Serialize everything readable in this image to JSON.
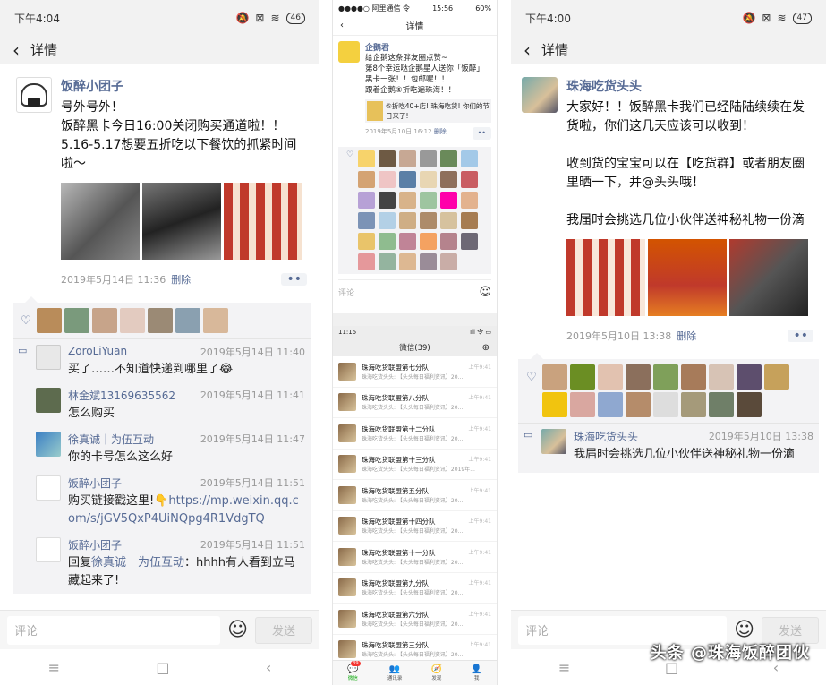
{
  "left": {
    "status": {
      "time": "下午4:04",
      "battery": "46"
    },
    "title": "详情",
    "post": {
      "author": "饭醉小团子",
      "text": "号外号外！\n饭醉黑卡今日16:00关闭购买通道啦！！5.16-5.17想要五折吃以下餐饮的抓紧时间啦～",
      "time": "2019年5月14日 11:36",
      "delete": "删除"
    },
    "comments": [
      {
        "name": "ZoroLiYuan",
        "time": "2019年5月14日 11:40",
        "text": "买了……不知道快递到哪里了😂"
      },
      {
        "name": "林金斌13169635562",
        "time": "2019年5月14日 11:41",
        "text": "怎么购买"
      },
      {
        "name": "徐真诚｜为伍互动",
        "time": "2019年5月14日 11:47",
        "text": "你的卡号怎么这么好"
      },
      {
        "name": "饭醉小团子",
        "time": "2019年5月14日 11:51",
        "text": "购买链接戳这里!👇",
        "link": "https://mp.weixin.qq.com/s/jGV5QxP4UiNQpg4R1VdgTQ"
      },
      {
        "name": "饭醉小团子",
        "time": "2019年5月14日 11:51",
        "reply_prefix": "回复",
        "reply_to": "徐真诚｜为伍互动",
        "text": "：hhhh有人看到立马藏起来了!"
      }
    ],
    "input_placeholder": "评论",
    "send": "发送"
  },
  "middle": {
    "status": {
      "carrier": "●●●●○ 阿里通信 令",
      "time": "15:56",
      "battery": "60%"
    },
    "title": "详情",
    "post": {
      "author": "企鹅君",
      "text": "给企鹅这条胖友圈点赞~\n第8个幸运哒企鹅星人送你「饭醉」黑卡一张！！包邮喔！！\n跟着企鹅⑤折吃遍珠海！！",
      "share": "⑤折吃40+店! 珠海吃货! 你们的节日来了!",
      "time": "2019年5月10日 16:12",
      "delete": "删除"
    },
    "input_placeholder": "评论",
    "chat_status": {
      "time": "11:15",
      "icons": "ıll 令 ▭"
    },
    "chat_title": "微信(39)",
    "chats": [
      {
        "name": "珠海吃货联盟第七分队",
        "msg": "珠海吃货头头: 【头头每日福利资讯】20...",
        "time": "上午9:41"
      },
      {
        "name": "珠海吃货联盟第八分队",
        "msg": "珠海吃货头头: 【头头每日福利资讯】20...",
        "time": "上午9:41"
      },
      {
        "name": "珠海吃货联盟第十二分队",
        "msg": "珠海吃货头头: 【头头每日福利资讯】20...",
        "time": "上午9:41"
      },
      {
        "name": "珠海吃货联盟第十三分队",
        "msg": "珠海吃货头头: 【头头每日福利资讯】2019年...",
        "time": "上午9:41"
      },
      {
        "name": "珠海吃货联盟第五分队",
        "msg": "珠海吃货头头: 【头头每日福利资讯】20...",
        "time": "上午9:41"
      },
      {
        "name": "珠海吃货联盟第十四分队",
        "msg": "珠海吃货头头: 【头头每日福利资讯】20...",
        "time": "上午9:41"
      },
      {
        "name": "珠海吃货联盟第十一分队",
        "msg": "珠海吃货头头: 【头头每日福利资讯】20...",
        "time": "上午9:41"
      },
      {
        "name": "珠海吃货联盟第九分队",
        "msg": "珠海吃货头头: 【头头每日福利资讯】20...",
        "time": "上午9:41"
      },
      {
        "name": "珠海吃货联盟第六分队",
        "msg": "珠海吃货头头: 【头头每日福利资讯】20...",
        "time": "上午9:41"
      },
      {
        "name": "珠海吃货联盟第三分队",
        "msg": "珠海吃货头头: 【头头每日福利资讯】20...",
        "time": "上午9:41"
      }
    ],
    "tabs": [
      {
        "label": "微信",
        "icon": "💬"
      },
      {
        "label": "通讯录",
        "icon": "👥"
      },
      {
        "label": "发现",
        "icon": "🧭"
      },
      {
        "label": "我",
        "icon": "👤"
      }
    ],
    "badge": "39"
  },
  "right": {
    "status": {
      "time": "下午4:00",
      "battery": "47"
    },
    "title": "详情",
    "post": {
      "author": "珠海吃货头头",
      "text": "大家好！！饭醉黑卡我们已经陆陆续续在发货啦，你们这几天应该可以收到！\n\n收到货的宝宝可以在【吃货群】或者朋友圈里晒一下，并@头头哦！\n\n我届时会挑选几位小伙伴送神秘礼物一份滴",
      "time": "2019年5月10日 13:38",
      "delete": "删除"
    },
    "comment": {
      "name": "珠海吃货头头",
      "time": "2019年5月10日 13:38",
      "text": "我届时会挑选几位小伙伴送神秘礼物一份滴"
    },
    "input_placeholder": "评论",
    "send": "发送"
  },
  "watermark": "头条 @珠海饭醉团伙",
  "colors": {
    "link": "#576b95",
    "bg_gray": "#f3f3f5",
    "green": "#1aad19"
  }
}
